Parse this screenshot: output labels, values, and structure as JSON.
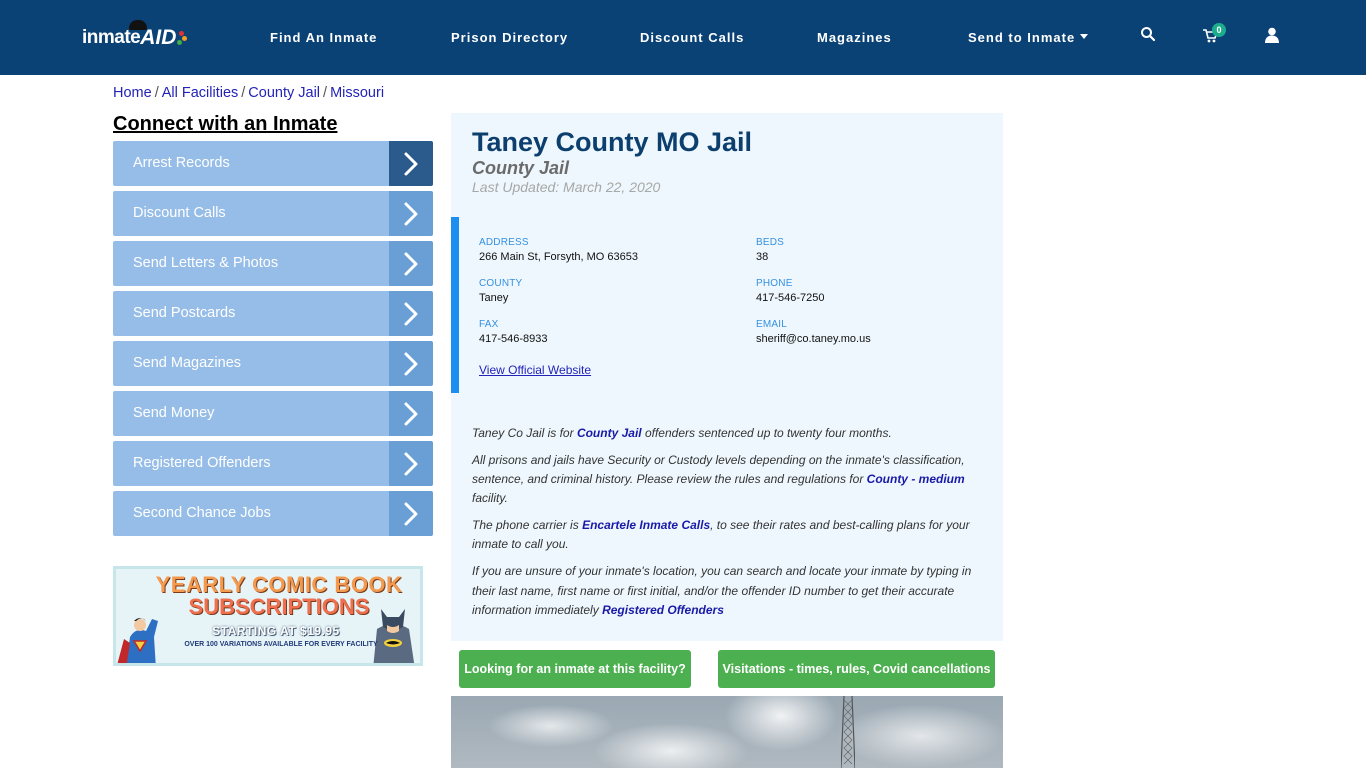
{
  "nav": {
    "logo_text_1": "inmate",
    "logo_text_2": "AID",
    "links": [
      "Find An Inmate",
      "Prison Directory",
      "Discount Calls",
      "Magazines",
      "Send to Inmate"
    ],
    "cart_count": "0",
    "icons": [
      "search-icon",
      "cart-icon",
      "user-icon"
    ]
  },
  "breadcrumb": [
    "Home",
    "All Facilities",
    "County Jail",
    "Missouri"
  ],
  "sidebar": {
    "title": "Connect with an Inmate",
    "items": [
      "Arrest Records",
      "Discount Calls",
      "Send Letters & Photos",
      "Send Postcards",
      "Send Magazines",
      "Send Money",
      "Registered Offenders",
      "Second Chance Jobs"
    ],
    "banner": {
      "line1": "YEARLY COMIC BOOK",
      "line2": "SUBSCRIPTIONS",
      "line3": "STARTING AT $19.95",
      "line4": "OVER 100 VARIATIONS AVAILABLE FOR EVERY FACILITY"
    }
  },
  "facility": {
    "name": "Taney County MO Jail",
    "type": "County Jail",
    "last_updated": "Last Updated: March 22, 2020",
    "info": {
      "address_label": "ADDRESS",
      "address": "266 Main St, Forsyth, MO 63653",
      "beds_label": "BEDS",
      "beds": "38",
      "county_label": "COUNTY",
      "county": "Taney",
      "phone_label": "PHONE",
      "phone": "417-546-7250",
      "fax_label": "FAX",
      "fax": "417-546-8933",
      "email_label": "EMAIL",
      "email": "sheriff@co.taney.mo.us"
    },
    "website_link": "View Official Website",
    "description": {
      "p1_a": "Taney Co Jail is for ",
      "p1_link": "County Jail",
      "p1_b": " offenders sentenced up to twenty four months.",
      "p2_a": "All prisons and jails have Security or Custody levels depending on the inmate's classification, sentence, and criminal history. Please review the rules and regulations for ",
      "p2_link": "County - medium",
      "p2_b": " facility.",
      "p3_a": "The phone carrier is ",
      "p3_link": "Encartele Inmate Calls",
      "p3_b": ", to see their rates and best-calling plans for your inmate to call you.",
      "p4_a": "If you are unsure of your inmate's location, you can search and locate your inmate by typing in their last name, first name or first initial, and/or the offender ID number to get their accurate information immediately ",
      "p4_link": "Registered Offenders"
    }
  },
  "buttons": {
    "find_inmate": "Looking for an inmate at this facility?",
    "visitations": "Visitations - times, rules, Covid cancellations"
  },
  "colors": {
    "navbar": "#0b4276",
    "sidebar_item": "#96bde8",
    "sidebar_arrow": "#6a9fd6",
    "sidebar_arrow_active": "#2b5a8d",
    "green_button": "#4caf50",
    "info_accent": "#1b8ef0",
    "panel_bg": "#eef7fd"
  }
}
